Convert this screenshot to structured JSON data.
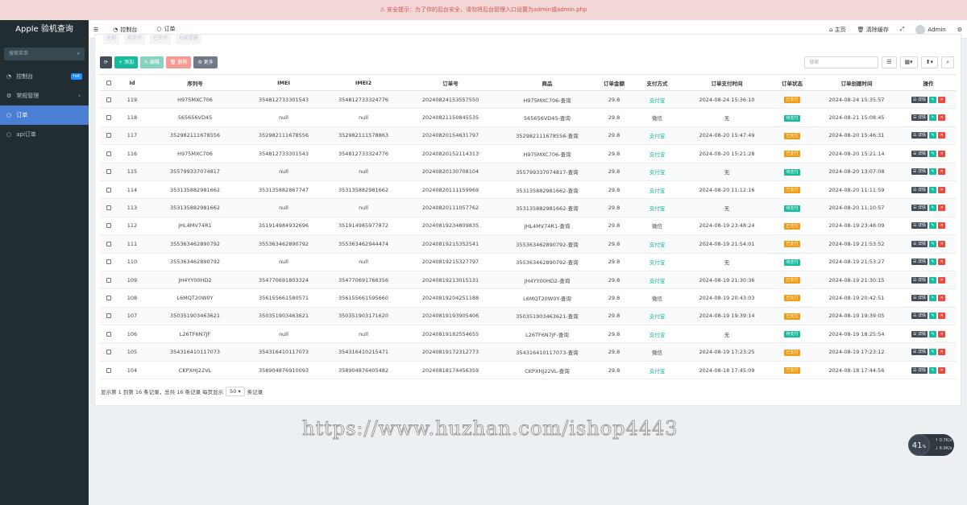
{
  "alert": {
    "text": "安全提示：为了你的后台安全，请勿将后台管理入口设置为admin或admin.php",
    "icon": "warning-icon"
  },
  "sidebar": {
    "title": "Apple 验机查询",
    "search_placeholder": "搜索菜单",
    "items": [
      {
        "label": "控制台",
        "icon": "dashboard-icon",
        "badge": "hot"
      },
      {
        "label": "常规管理",
        "icon": "cogs-icon"
      },
      {
        "label": "订单",
        "icon": "circle-icon",
        "active": true
      },
      {
        "label": "api订单",
        "icon": "circle-icon"
      }
    ]
  },
  "topbar": {
    "tabs": [
      {
        "label": "控制台",
        "icon": "dashboard-icon"
      },
      {
        "label": "订单",
        "icon": "circle-icon"
      }
    ],
    "home": "主页",
    "clear_cache": "清除缓存",
    "user": "Admin"
  },
  "subtabs": [
    "全部",
    "待支付",
    "已支付",
    "功能提醒"
  ],
  "toolbar": {
    "add": "添加",
    "edit": "编辑",
    "delete": "删除",
    "more": "更多",
    "search_placeholder": "搜索"
  },
  "table": {
    "headers": [
      "Id",
      "序列号",
      "IMEI",
      "IMEI2",
      "订单号",
      "商品",
      "订单金额",
      "支付方式",
      "订单支付时间",
      "订单状态",
      "订单创建时间",
      "操作"
    ],
    "rows": [
      [
        "119",
        "H975MXC706",
        "354812733301543",
        "354812733324776",
        "20240824153557550",
        "H975MXC706-查询",
        "29.8",
        "支付宝",
        "2024-08-24 15:36:10",
        "已支付",
        "2024-08-24 15:35:57"
      ],
      [
        "118",
        "565656VD45",
        "null",
        "null",
        "20240821150845535",
        "565656VD45-查询",
        "29.8",
        "微信",
        "无",
        "待支付",
        "2024-08-21 15:08:45"
      ],
      [
        "117",
        "352982111678556",
        "352982111678556",
        "352982111578863",
        "20240820154631797",
        "352982111678556-查询",
        "29.8",
        "支付宝",
        "2024-08-20 15:47:49",
        "已支付",
        "2024-08-20 15:46:31"
      ],
      [
        "116",
        "H975MXC706",
        "354812733301543",
        "354812733324776",
        "20240820152114313",
        "H975MXC706-查询",
        "29.8",
        "支付宝",
        "2024-08-20 15:21:28",
        "已支付",
        "2024-08-20 15:21:14"
      ],
      [
        "115",
        "355799337074817",
        "null",
        "null",
        "20240820130708104",
        "355799337074817-查询",
        "29.8",
        "支付宝",
        "无",
        "待支付",
        "2024-08-20 13:07:08"
      ],
      [
        "114",
        "353135882981662",
        "353135882867747",
        "353135882981662",
        "20240820111159969",
        "353135882981662-查询",
        "29.8",
        "支付宝",
        "2024-08-20 11:12:16",
        "已支付",
        "2024-08-20 11:11:59"
      ],
      [
        "113",
        "353135882981662",
        "null",
        "null",
        "20240820111057762",
        "353135882981662-查询",
        "29.8",
        "支付宝",
        "无",
        "待支付",
        "2024-08-20 11:10:57"
      ],
      [
        "112",
        "JHL4MV74R1",
        "351914984932696",
        "351914985977872",
        "20240819234809835",
        "JHL4MV74R1-查询",
        "29.8",
        "微信",
        "2024-08-19 23:48:24",
        "已支付",
        "2024-08-19 23:48:09"
      ],
      [
        "111",
        "355363462890792",
        "355363462890792",
        "355363462944474",
        "20240819215352541",
        "355363462890792-查询",
        "29.8",
        "支付宝",
        "2024-08-19 21:54:01",
        "已支付",
        "2024-08-19 21:53:52"
      ],
      [
        "110",
        "355363462890792",
        "null",
        "null",
        "20240819215327797",
        "355363462890792-查询",
        "29.8",
        "支付宝",
        "无",
        "待支付",
        "2024-08-19 21:53:27"
      ],
      [
        "109",
        "JH4YY00HD2",
        "354770691803324",
        "354770691766356",
        "20240819213015131",
        "JH4YY00HD2-查询",
        "29.8",
        "支付宝",
        "2024-08-19 21:30:36",
        "已支付",
        "2024-08-19 21:30:15"
      ],
      [
        "108",
        "L6MQT20W0Y",
        "356155661580571",
        "356155661595660",
        "20240819204251188",
        "L6MQT20W0Y-查询",
        "29.8",
        "微信",
        "2024-08-19 20:43:03",
        "已支付",
        "2024-08-19 20:42:51"
      ],
      [
        "107",
        "350351903463621",
        "350351903463621",
        "350351903171620",
        "20240819193905406",
        "350351903463621-查询",
        "29.8",
        "支付宝",
        "2024-08-19 19:39:14",
        "已支付",
        "2024-08-19 19:39:05"
      ],
      [
        "106",
        "L26TF6N7JF",
        "null",
        "null",
        "20240819182554655",
        "L26TF6N7JF-查询",
        "29.8",
        "支付宝",
        "无",
        "待支付",
        "2024-08-19 18:25:54"
      ],
      [
        "105",
        "354316410117073",
        "354316410117073",
        "354316410215471",
        "20240819172312773",
        "354316410117073-查询",
        "29.8",
        "微信",
        "2024-08-19 17:23:25",
        "已支付",
        "2024-08-19 17:23:12"
      ],
      [
        "104",
        "CKPXHJ22VL",
        "358904876910093",
        "358904876405482",
        "20240818174456359",
        "CKPXHJ22VL-查询",
        "29.8",
        "支付宝",
        "2024-08-18 17:45:09",
        "已支付",
        "2024-08-18 17:44:56"
      ]
    ],
    "action_detail": "详情"
  },
  "pager": {
    "text1": "显示第 1 到第 16 条记录，总共 16 条记录 每页显示",
    "per_page": "50",
    "text2": "条记录"
  },
  "watermark": "https://www.huzhan.com/ishop4443",
  "widget": {
    "value": "41",
    "unit": "%",
    "up": "0.7K/s",
    "down": "6.9K/s"
  },
  "colors": {
    "sidebar": "#222d32",
    "accent": "#4a7fd4",
    "green": "#18bc9c",
    "orange": "#f39c12",
    "red": "#e74c3c"
  }
}
